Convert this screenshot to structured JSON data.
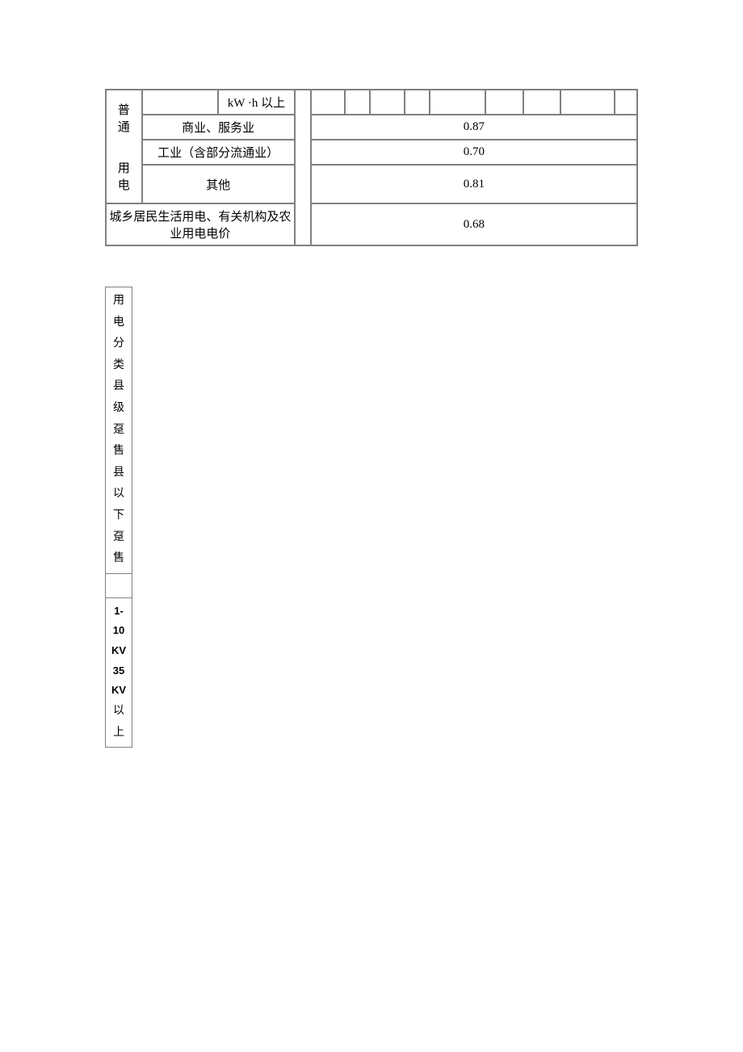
{
  "table1": {
    "headerCell": "kW ·h 以上",
    "leftHeader": "普通用电",
    "rows": [
      {
        "label": "商业、服务业",
        "value": "0.87"
      },
      {
        "label": "工业（含部分流通业）",
        "value": "0.70"
      },
      {
        "label": "其他",
        "value": "0.81"
      }
    ],
    "footerLabel": "城乡居民生活用电、有关机构及农业用电电价",
    "footerValue": "0.68"
  },
  "table2": {
    "lines": [
      "用",
      "电",
      "分",
      "类",
      "县",
      "级",
      "趸",
      "售",
      "县",
      "以",
      "下",
      "趸",
      "售"
    ],
    "voltage": {
      "line1": "1-",
      "line2": "10",
      "line3": "KV",
      "line4": "35",
      "line5": "KV",
      "line6": "以",
      "line7": "上"
    }
  }
}
